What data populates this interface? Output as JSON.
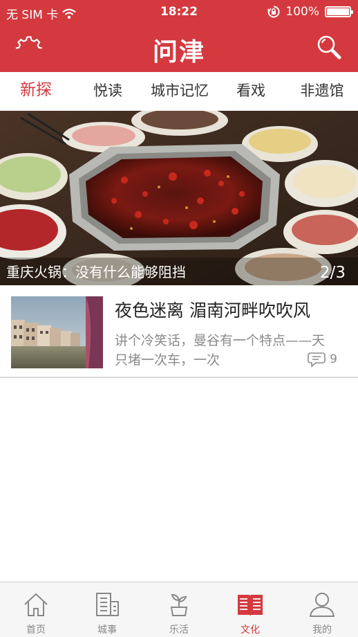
{
  "status_bar": {
    "carrier": "无 SIM 卡",
    "time": "18:22",
    "battery": "100%",
    "battery_level": 1.0
  },
  "header": {
    "logo": "问津",
    "settings_icon": "gear-icon",
    "search_icon": "search-icon"
  },
  "tabs": [
    {
      "label": "新探",
      "active": true
    },
    {
      "label": "悦读",
      "active": false
    },
    {
      "label": "城市记忆",
      "active": false
    },
    {
      "label": "看戏",
      "active": false
    },
    {
      "label": "非遗馆",
      "active": false
    }
  ],
  "hero": {
    "caption": "重庆火锅：没有什么能够阻挡",
    "pager": "2/3"
  },
  "articles": [
    {
      "title": "夜色迷离 湄南河畔吹吹风",
      "summary": "讲个冷笑话，曼谷有一个特点——天只堵一次车，一次",
      "comment_count": "9",
      "comment_icon": "comment-icon"
    }
  ],
  "tabbar": [
    {
      "label": "首页",
      "icon": "home-icon",
      "active": false
    },
    {
      "label": "城事",
      "icon": "building-icon",
      "active": false
    },
    {
      "label": "乐活",
      "icon": "plant-icon",
      "active": false
    },
    {
      "label": "文化",
      "icon": "book-icon",
      "active": true
    },
    {
      "label": "我的",
      "icon": "person-icon",
      "active": false
    }
  ],
  "colors": {
    "brand": "#d3393e",
    "tab_text": "#333333",
    "muted": "#888888"
  }
}
